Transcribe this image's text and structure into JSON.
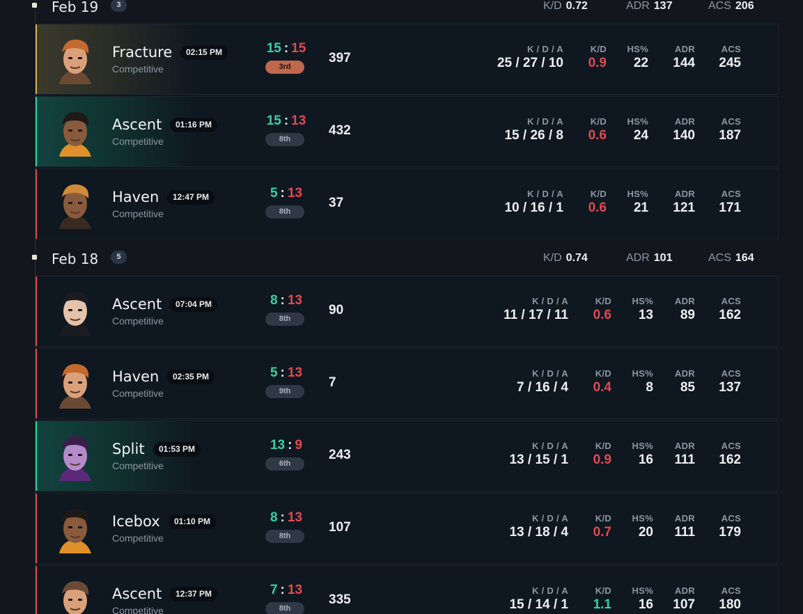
{
  "days": [
    {
      "date": "Feb 19",
      "count": "3",
      "kd_label": "K/D",
      "kd": "0.72",
      "adr_label": "ADR",
      "adr": "137",
      "acs_label": "ACS",
      "acs": "206",
      "matches": [
        {
          "map": "Fracture",
          "time": "02:15 PM",
          "queue": "Competitive",
          "score_us": "15",
          "score_them": "15",
          "place": "3rd",
          "rr": "397",
          "kda": "25 / 27 / 10",
          "kd": "0.9",
          "hs": "22",
          "adr": "144",
          "acs": "245",
          "result": "draw",
          "agent_icon": "agent-brimstone-icon"
        },
        {
          "map": "Ascent",
          "time": "01:16 PM",
          "queue": "Competitive",
          "score_us": "15",
          "score_them": "13",
          "place": "8th",
          "rr": "432",
          "kda": "15 / 26 / 8",
          "kd": "0.6",
          "hs": "24",
          "adr": "140",
          "acs": "187",
          "result": "win",
          "agent_icon": "agent-phoenix-icon"
        },
        {
          "map": "Haven",
          "time": "12:47 PM",
          "queue": "Competitive",
          "score_us": "5",
          "score_them": "13",
          "place": "8th",
          "rr": "37",
          "kda": "10 / 16 / 1",
          "kd": "0.6",
          "hs": "21",
          "adr": "121",
          "acs": "171",
          "result": "loss",
          "agent_icon": "agent-raze-icon"
        }
      ]
    },
    {
      "date": "Feb 18",
      "count": "5",
      "kd_label": "K/D",
      "kd": "0.74",
      "adr_label": "ADR",
      "adr": "101",
      "acs_label": "ACS",
      "acs": "164",
      "matches": [
        {
          "map": "Ascent",
          "time": "07:04 PM",
          "queue": "Competitive",
          "score_us": "8",
          "score_them": "13",
          "place": "8th",
          "rr": "90",
          "kda": "11 / 17 / 11",
          "kd": "0.6",
          "hs": "13",
          "adr": "89",
          "acs": "162",
          "result": "loss",
          "agent_icon": "agent-sage-icon"
        },
        {
          "map": "Haven",
          "time": "02:35 PM",
          "queue": "Competitive",
          "score_us": "5",
          "score_them": "13",
          "place": "9th",
          "rr": "7",
          "kda": "7 / 16 / 4",
          "kd": "0.4",
          "hs": "8",
          "adr": "85",
          "acs": "137",
          "result": "loss",
          "agent_icon": "agent-brimstone-icon"
        },
        {
          "map": "Split",
          "time": "01:53 PM",
          "queue": "Competitive",
          "score_us": "13",
          "score_them": "9",
          "place": "6th",
          "rr": "243",
          "kda": "13 / 15 / 1",
          "kd": "0.9",
          "hs": "16",
          "adr": "111",
          "acs": "162",
          "result": "win",
          "agent_icon": "agent-reyna-icon"
        },
        {
          "map": "Icebox",
          "time": "01:10 PM",
          "queue": "Competitive",
          "score_us": "8",
          "score_them": "13",
          "place": "8th",
          "rr": "107",
          "kda": "13 / 18 / 4",
          "kd": "0.7",
          "hs": "20",
          "adr": "111",
          "acs": "179",
          "result": "loss",
          "agent_icon": "agent-phoenix-icon"
        },
        {
          "map": "Ascent",
          "time": "12:37 PM",
          "queue": "Competitive",
          "score_us": "7",
          "score_them": "13",
          "place": "8th",
          "rr": "335",
          "kda": "15 / 14 / 1",
          "kd": "1.1",
          "hs": "16",
          "adr": "107",
          "acs": "180",
          "result": "loss",
          "agent_icon": "agent-chamber-icon"
        }
      ]
    }
  ],
  "stat_labels": {
    "kda": "K / D / A",
    "kd": "K/D",
    "hs": "HS%",
    "adr": "ADR",
    "acs": "ACS"
  },
  "colors": {
    "win": "#36d3a4",
    "loss": "#e04a54",
    "draw": "#d4b64a",
    "background": "#13161d",
    "card": "#0f1720",
    "mvp_place": "#c0684c"
  }
}
